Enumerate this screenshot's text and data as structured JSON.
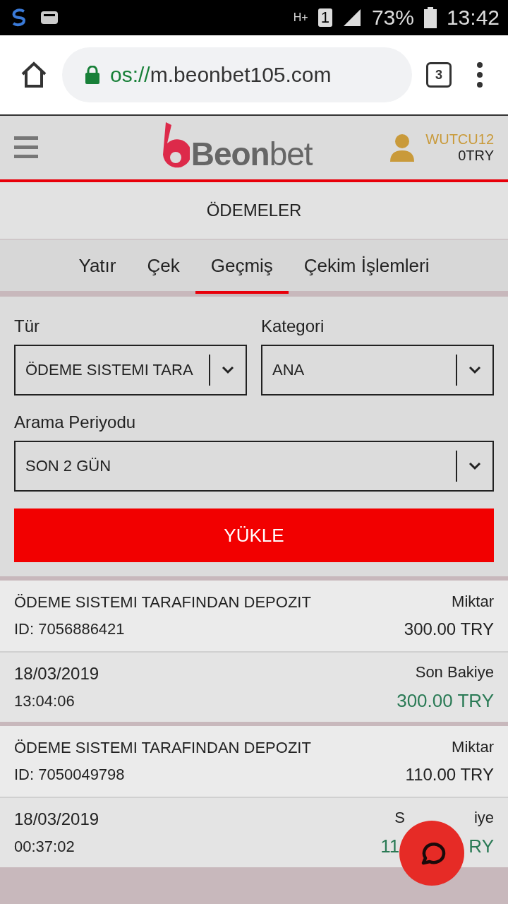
{
  "status_bar": {
    "network": "H+",
    "sim": "1",
    "battery": "73%",
    "time": "13:42"
  },
  "browser": {
    "url_scheme": "os://",
    "url_host": "m.beonbet105.com",
    "tab_count": "3"
  },
  "header": {
    "logo": "**Beon**bet",
    "username": "WUTCU12",
    "balance": "0TRY"
  },
  "page_title": "ÖDEMELER",
  "tabs": [
    {
      "label": "Yatır",
      "selected": false
    },
    {
      "label": "Çek",
      "selected": false
    },
    {
      "label": "Geçmiş",
      "selected": true
    },
    {
      "label": "Çekim İşlemleri",
      "selected": false
    }
  ],
  "filters": [
    {
      "label": "Tür",
      "value": "ÖDEME SISTEMI TARA",
      "wide": false
    },
    {
      "label": "Kategori",
      "value": "ANA",
      "wide": false
    },
    {
      "label": "Arama Periyodu",
      "value": "SON 2 GÜN",
      "wide": true
    }
  ],
  "load_button": "YÜKLE",
  "transactions": [
    {
      "type": "ÖDEME SISTEMI TARAFINDAN DEPOZIT",
      "amount_label": "Miktar",
      "id": "ID: 7056886421",
      "amount": "300.00 TRY",
      "date": "18/03/2019",
      "time": "13:04:06",
      "balance_label": "Son Bakiye",
      "balance": "300.00 TRY"
    },
    {
      "type": "ÖDEME SISTEMI TARAFINDAN DEPOZIT",
      "amount_label": "Miktar",
      "id": "ID: 7050049798",
      "amount": "110.00 TRY",
      "date": "18/03/2019",
      "time": "00:37:02",
      "balance_label_parts": [
        "S",
        "iye"
      ],
      "balance_parts": [
        "11",
        "RY"
      ]
    }
  ]
}
